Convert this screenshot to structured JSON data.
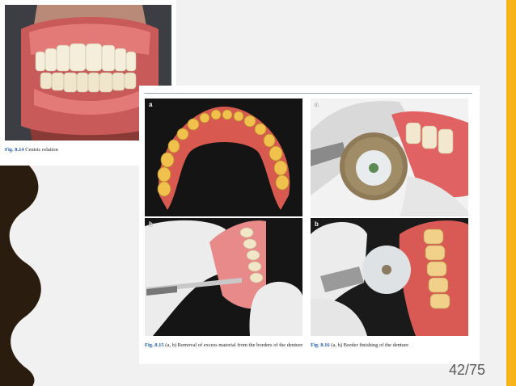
{
  "slide": {
    "page_number": "42/75",
    "accent_color": "#f4b41a",
    "band_color": "#2a1c0e"
  },
  "figure_top": {
    "number": "Fig. 8.14",
    "caption": "Centric relation"
  },
  "figure_main": {
    "panels": [
      {
        "letter": "a",
        "subject": "mandibular-denture-occlusal-view"
      },
      {
        "letter": "a",
        "subject": "denture-polishing-wheel"
      },
      {
        "letter": "b",
        "subject": "denture-border-trimming-blade"
      },
      {
        "letter": "b",
        "subject": "denture-border-finishing-disc"
      }
    ],
    "caption_left_number": "Fig. 8.15",
    "caption_left_text": "(a, b) Removal of excess material from the borders of the denture",
    "caption_right_number": "Fig. 8.16",
    "caption_right_text": "(a, b) Border finishing of the denture"
  }
}
